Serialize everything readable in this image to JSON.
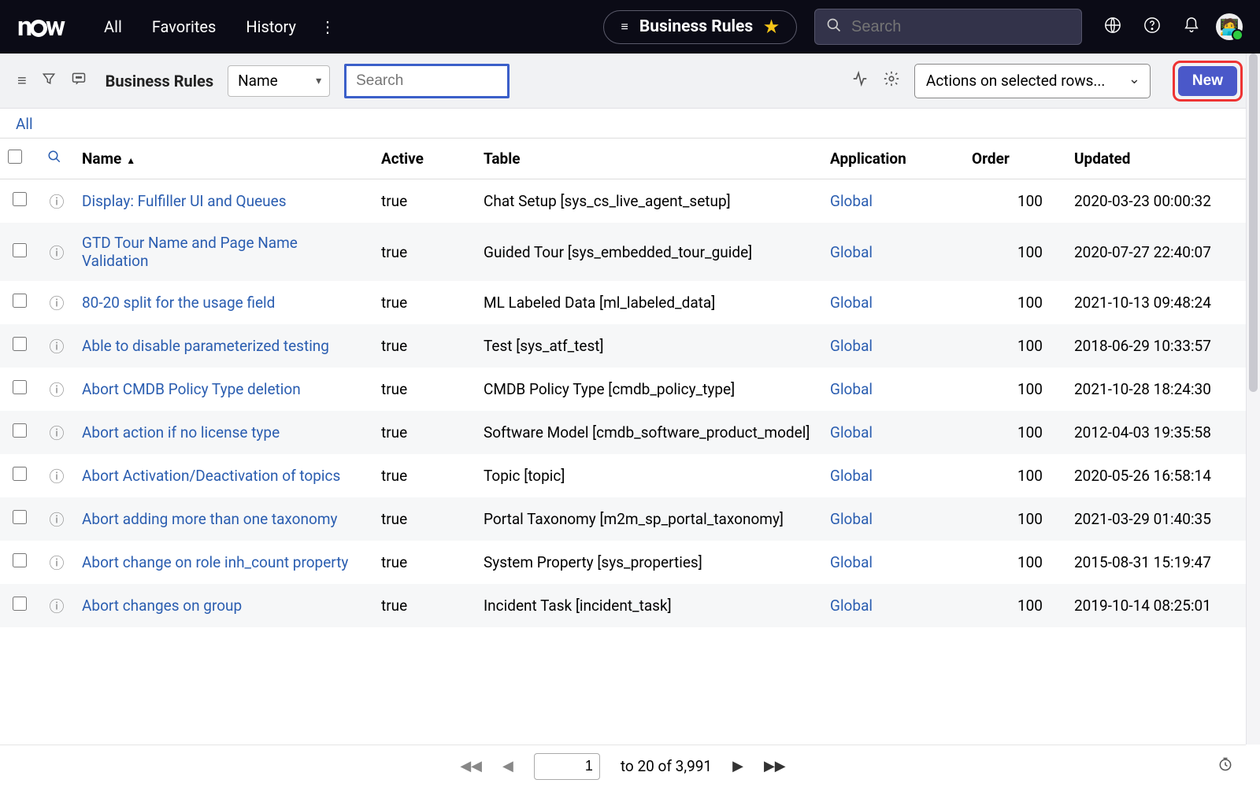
{
  "topnav": {
    "logo": "now",
    "links": [
      "All",
      "Favorites",
      "History"
    ],
    "pill_label": "Business Rules",
    "search_placeholder": "Search"
  },
  "toolbar": {
    "title": "Business Rules",
    "field_select": "Name",
    "search_placeholder": "Search",
    "actions_label": "Actions on selected rows...",
    "new_label": "New"
  },
  "crumbs": {
    "all": "All"
  },
  "columns": {
    "name": "Name",
    "active": "Active",
    "table": "Table",
    "application": "Application",
    "order": "Order",
    "updated": "Updated"
  },
  "rows": [
    {
      "name": "Display: Fulfiller UI and Queues",
      "active": "true",
      "table": "Chat Setup [sys_cs_live_agent_setup]",
      "app": "Global",
      "order": "100",
      "updated": "2020-03-23 00:00:32"
    },
    {
      "name": "GTD Tour Name and Page Name Validation",
      "active": "true",
      "table": "Guided Tour [sys_embedded_tour_guide]",
      "app": "Global",
      "order": "100",
      "updated": "2020-07-27 22:40:07"
    },
    {
      "name": "80-20 split for the usage field",
      "active": "true",
      "table": "ML Labeled Data [ml_labeled_data]",
      "app": "Global",
      "order": "100",
      "updated": "2021-10-13 09:48:24"
    },
    {
      "name": "Able to disable parameterized testing",
      "active": "true",
      "table": "Test [sys_atf_test]",
      "app": "Global",
      "order": "100",
      "updated": "2018-06-29 10:33:57"
    },
    {
      "name": "Abort CMDB Policy Type deletion",
      "active": "true",
      "table": "CMDB Policy Type [cmdb_policy_type]",
      "app": "Global",
      "order": "100",
      "updated": "2021-10-28 18:24:30"
    },
    {
      "name": "Abort action if no license type",
      "active": "true",
      "table": "Software Model [cmdb_software_product_model]",
      "app": "Global",
      "order": "100",
      "updated": "2012-04-03 19:35:58"
    },
    {
      "name": "Abort Activation/Deactivation of topics",
      "active": "true",
      "table": "Topic [topic]",
      "app": "Global",
      "order": "100",
      "updated": "2020-05-26 16:58:14"
    },
    {
      "name": "Abort adding more than one taxonomy",
      "active": "true",
      "table": "Portal Taxonomy [m2m_sp_portal_taxonomy]",
      "app": "Global",
      "order": "100",
      "updated": "2021-03-29 01:40:35"
    },
    {
      "name": "Abort change on role inh_count property",
      "active": "true",
      "table": "System Property [sys_properties]",
      "app": "Global",
      "order": "100",
      "updated": "2015-08-31 15:19:47"
    },
    {
      "name": "Abort changes on group",
      "active": "true",
      "table": "Incident Task [incident_task]",
      "app": "Global",
      "order": "100",
      "updated": "2019-10-14 08:25:01"
    }
  ],
  "pager": {
    "page_input": "1",
    "range_text": "to 20 of 3,991"
  }
}
